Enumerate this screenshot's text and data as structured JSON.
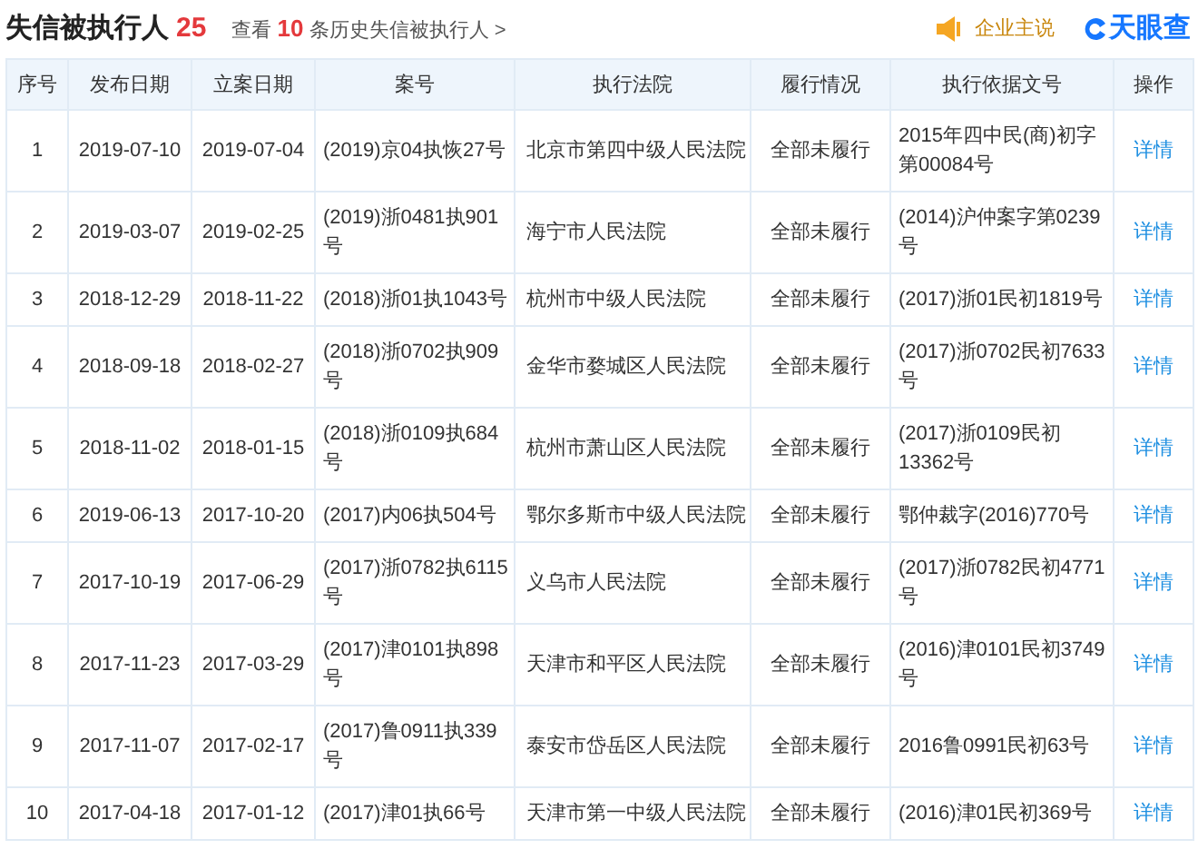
{
  "header": {
    "title": "失信被执行人",
    "count": "25",
    "history_link": "查看 **10** 条历史失信被执行人 >",
    "claim_button": "企业主说",
    "logo": "天眼查"
  },
  "table": {
    "columns": [
      "序号",
      "发布日期",
      "立案日期",
      "案号",
      "执行法院",
      "履行情况",
      "执行依据文号",
      "操作"
    ],
    "rows": [
      [
        "1",
        "2019-07-10",
        "2019-07-04",
        "(2019)京04执恢27号",
        "北京市第四中级人民法院",
        "全部未履行",
        "2015年四中民(商)初字第00084号",
        "详情"
      ],
      [
        "2",
        "2019-03-07",
        "2019-02-25",
        "(2019)浙0481执901号",
        "海宁市人民法院",
        "全部未履行",
        "(2014)沪仲案字第0239号",
        "详情"
      ],
      [
        "3",
        "2018-12-29",
        "2018-11-22",
        "(2018)浙01执1043号",
        "杭州市中级人民法院",
        "全部未履行",
        "(2017)浙01民初1819号",
        "详情"
      ],
      [
        "4",
        "2018-09-18",
        "2018-02-27",
        "(2018)浙0702执909号",
        "金华市婺城区人民法院",
        "全部未履行",
        "(2017)浙0702民初7633号",
        "详情"
      ],
      [
        "5",
        "2018-11-02",
        "2018-01-15",
        "(2018)浙0109执684号",
        "杭州市萧山区人民法院",
        "全部未履行",
        "(2017)浙0109民初13362号",
        "详情"
      ],
      [
        "6",
        "2019-06-13",
        "2017-10-20",
        "(2017)内06执504号",
        "鄂尔多斯市中级人民法院",
        "全部未履行",
        "鄂仲裁字(2016)770号",
        "详情"
      ],
      [
        "7",
        "2017-10-19",
        "2017-06-29",
        "(2017)浙0782执6115号",
        "义乌市人民法院",
        "全部未履行",
        "(2017)浙0782民初4771号",
        "详情"
      ],
      [
        "8",
        "2017-11-23",
        "2017-03-29",
        "(2017)津0101执898号",
        "天津市和平区人民法院",
        "全部未履行",
        "(2016)津0101民初3749号",
        "详情"
      ],
      [
        "9",
        "2017-11-07",
        "2017-02-17",
        "(2017)鲁0911执339号",
        "泰安市岱岳区人民法院",
        "全部未履行",
        "2016鲁0991民初63号",
        "详情"
      ],
      [
        "10",
        "2017-04-18",
        "2017-01-12",
        "(2017)津01执66号",
        "天津市第一中级人民法院",
        "全部未履行",
        "(2016)津01民初369号",
        "详情"
      ]
    ]
  }
}
